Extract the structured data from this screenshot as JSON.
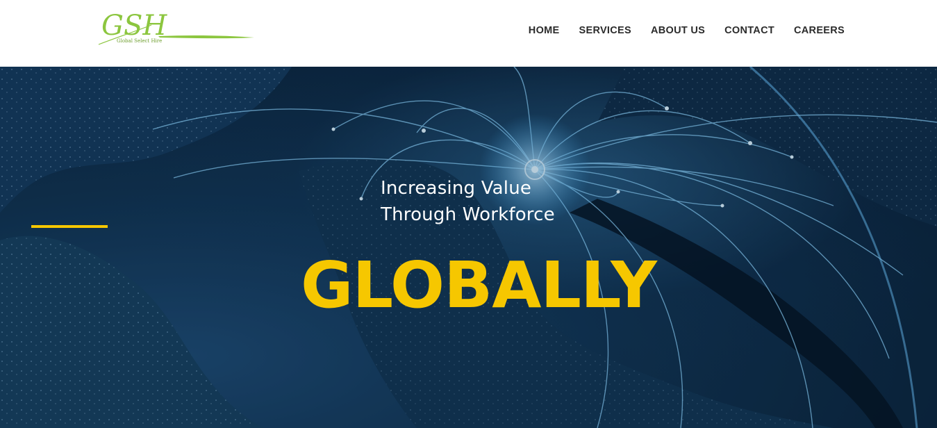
{
  "brand": {
    "logo_text": "GSH",
    "logo_subtext": "Global Select Hire",
    "logo_color": "#8cc63f"
  },
  "nav": {
    "items": [
      {
        "label": "HOME"
      },
      {
        "label": "SERVICES"
      },
      {
        "label": "ABOUT US"
      },
      {
        "label": "CONTACT"
      },
      {
        "label": "CAREERS"
      }
    ]
  },
  "hero": {
    "tagline_line1": "Increasing Value",
    "tagline_line2": "Through Workforce",
    "headline": "GLOBALLY",
    "accent_color": "#f6c700",
    "background_image": "night-earth-network-map"
  }
}
